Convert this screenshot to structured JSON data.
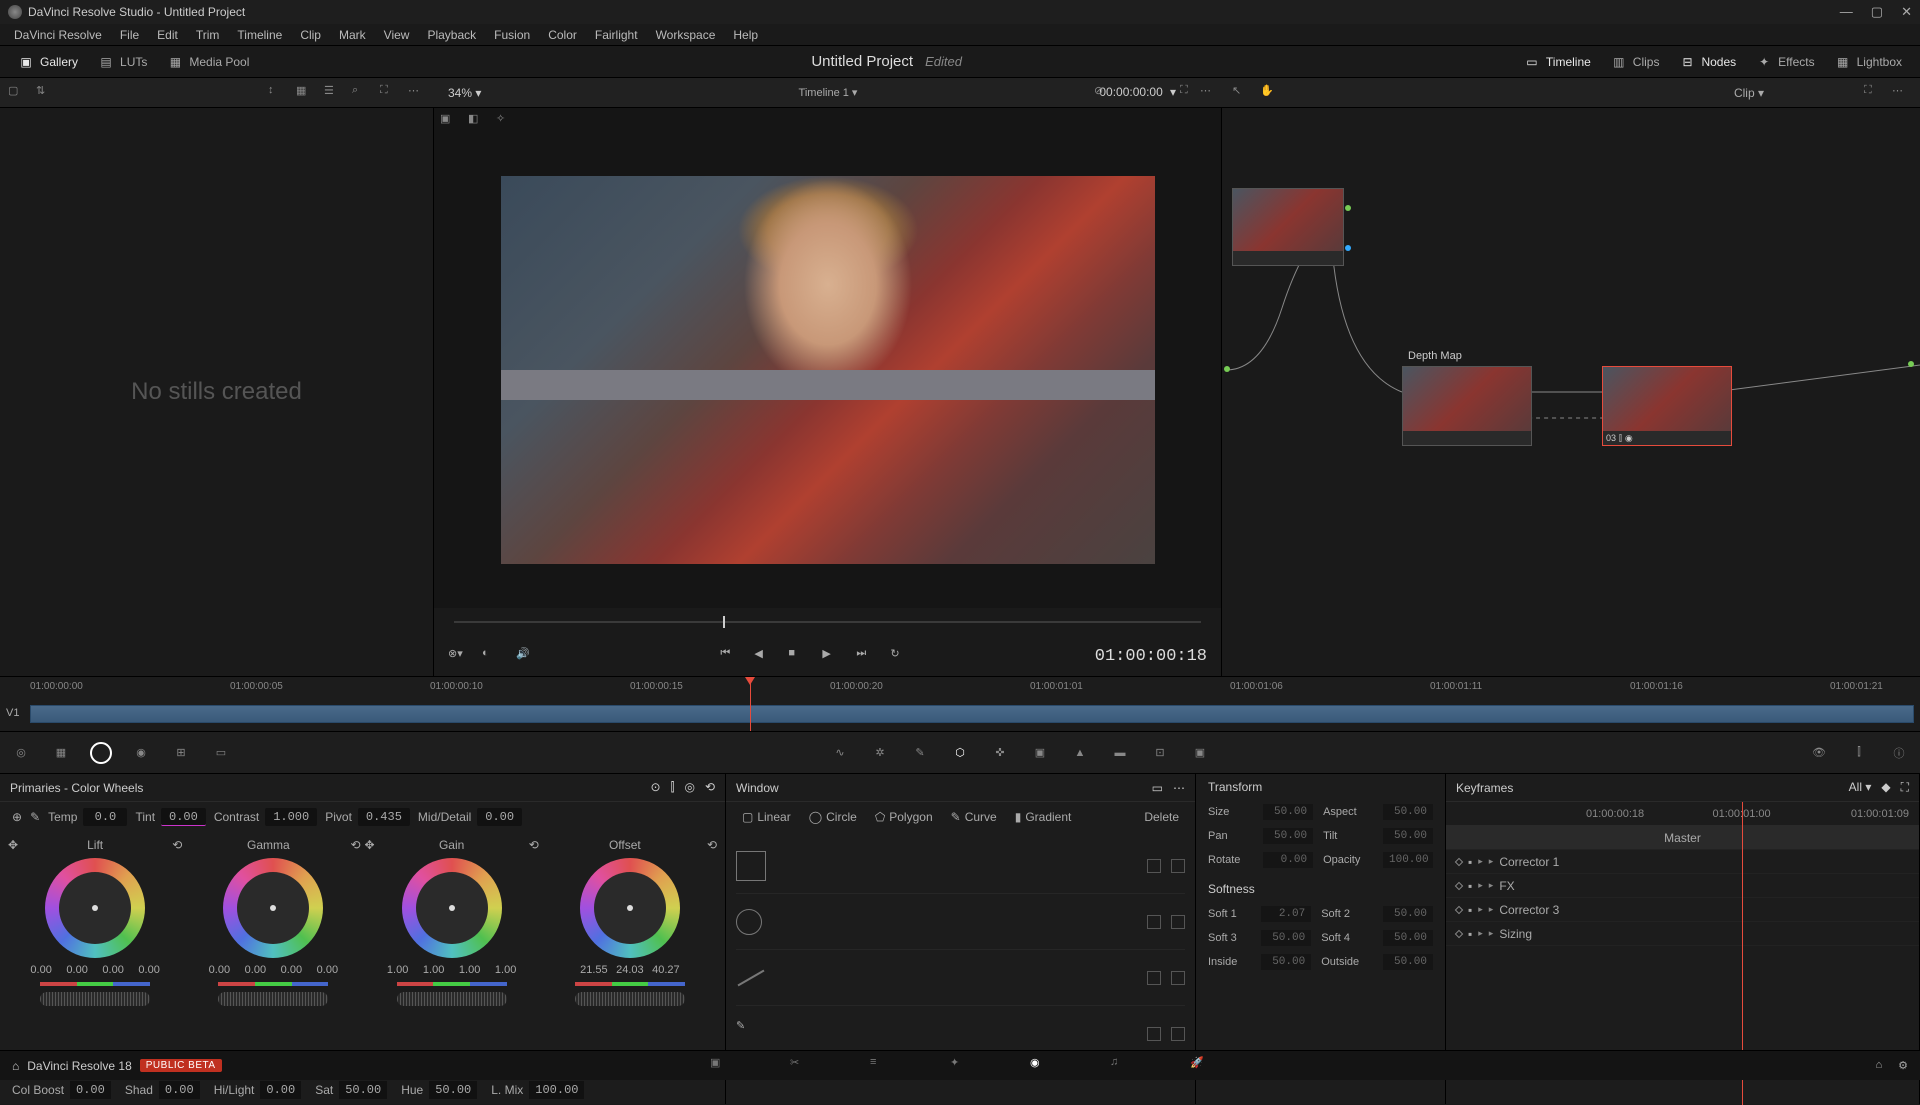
{
  "title": "DaVinci Resolve Studio - Untitled Project",
  "menu": [
    "DaVinci Resolve",
    "File",
    "Edit",
    "Trim",
    "Timeline",
    "Clip",
    "Mark",
    "View",
    "Playback",
    "Fusion",
    "Color",
    "Fairlight",
    "Workspace",
    "Help"
  ],
  "topbar": {
    "gallery": "Gallery",
    "luts": "LUTs",
    "mediapool": "Media Pool",
    "project": "Untitled Project",
    "edited": "Edited",
    "timeline": "Timeline",
    "clips": "Clips",
    "nodes": "Nodes",
    "effects": "Effects",
    "lightbox": "Lightbox"
  },
  "subbar": {
    "zoom": "34%",
    "timeline_name": "Timeline 1",
    "timecode": "00:00:00:00",
    "clip": "Clip"
  },
  "gallery_empty": "No stills created",
  "viewer_tc": "01:00:00:18",
  "nodes": {
    "depthmap": "Depth Map",
    "n3id": "03"
  },
  "ruler": [
    "01:00:00:00",
    "01:00:00:05",
    "01:00:00:10",
    "01:00:00:15",
    "01:00:00:20",
    "01:00:01:01",
    "01:00:01:06",
    "01:00:01:11",
    "01:00:01:16",
    "01:00:01:21"
  ],
  "track": "V1",
  "primaries": {
    "title": "Primaries - Color Wheels",
    "temp_l": "Temp",
    "temp": "0.0",
    "tint_l": "Tint",
    "tint": "0.00",
    "contrast_l": "Contrast",
    "contrast": "1.000",
    "pivot_l": "Pivot",
    "pivot": "0.435",
    "md_l": "Mid/Detail",
    "md": "0.00",
    "wheels": {
      "lift": {
        "name": "Lift",
        "vals": [
          "0.00",
          "0.00",
          "0.00",
          "0.00"
        ]
      },
      "gamma": {
        "name": "Gamma",
        "vals": [
          "0.00",
          "0.00",
          "0.00",
          "0.00"
        ]
      },
      "gain": {
        "name": "Gain",
        "vals": [
          "1.00",
          "1.00",
          "1.00",
          "1.00"
        ]
      },
      "offset": {
        "name": "Offset",
        "vals": [
          "21.55",
          "24.03",
          "40.27"
        ]
      }
    },
    "bot": {
      "cb_l": "Col Boost",
      "cb": "0.00",
      "sh_l": "Shad",
      "sh": "0.00",
      "hl_l": "Hi/Light",
      "hl": "0.00",
      "sat_l": "Sat",
      "sat": "50.00",
      "hue_l": "Hue",
      "hue": "50.00",
      "lm_l": "L. Mix",
      "lm": "100.00"
    }
  },
  "window": {
    "title": "Window",
    "shapes": {
      "linear": "Linear",
      "circle": "Circle",
      "polygon": "Polygon",
      "curve": "Curve",
      "gradient": "Gradient",
      "delete": "Delete"
    }
  },
  "transform": {
    "title": "Transform",
    "size_l": "Size",
    "size": "50.00",
    "aspect_l": "Aspect",
    "aspect": "50.00",
    "pan_l": "Pan",
    "pan": "50.00",
    "tilt_l": "Tilt",
    "tilt": "50.00",
    "rotate_l": "Rotate",
    "rotate": "0.00",
    "opacity_l": "Opacity",
    "opacity": "100.00",
    "soft_title": "Softness",
    "s1_l": "Soft 1",
    "s1": "2.07",
    "s2_l": "Soft 2",
    "s2": "50.00",
    "s3_l": "Soft 3",
    "s3": "50.00",
    "s4_l": "Soft 4",
    "s4": "50.00",
    "in_l": "Inside",
    "in": "50.00",
    "out_l": "Outside",
    "out": "50.00"
  },
  "keyframes": {
    "title": "Keyframes",
    "all": "All",
    "times": [
      "01:00:00:18",
      "01:00:01:00",
      "01:00:01:09"
    ],
    "master": "Master",
    "rows": [
      "Corrector 1",
      "FX",
      "Corrector 3",
      "Sizing"
    ]
  },
  "footer": {
    "app": "DaVinci Resolve 18",
    "badge": "PUBLIC BETA"
  }
}
